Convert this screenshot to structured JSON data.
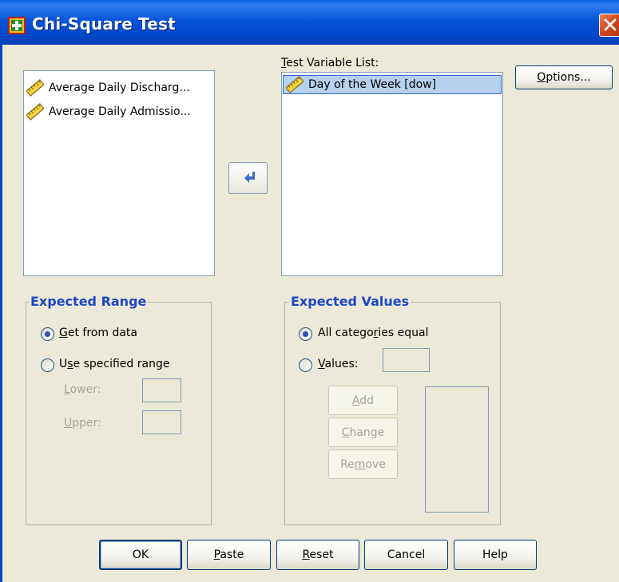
{
  "window": {
    "title": "Chi-Square Test"
  },
  "source_list": {
    "items": [
      {
        "label": "Average Daily Discharg...",
        "icon": "scale-ruler-icon"
      },
      {
        "label": "Average Daily Admissio...",
        "icon": "scale-ruler-icon"
      }
    ]
  },
  "move_button": {
    "icon": "arrow-left-icon"
  },
  "test_variable": {
    "label_prefix": "T",
    "label_rest": "est Variable List:",
    "items": [
      {
        "label": "Day of the Week [dow]",
        "icon": "scale-ruler-icon",
        "selected": true
      }
    ]
  },
  "options_button": {
    "mnemonic": "O",
    "rest": "ptions..."
  },
  "expected_range": {
    "title": "Expected Range",
    "get_from_data": {
      "mnemonic": "G",
      "rest": "et from data",
      "checked": true
    },
    "use_specified": {
      "pre": "U",
      "mnemonic": "s",
      "rest": "e specified range",
      "checked": false
    },
    "lower": {
      "mnemonic": "L",
      "rest": "ower:",
      "value": ""
    },
    "upper": {
      "mnemonic": "U",
      "rest": "pper:",
      "value": ""
    }
  },
  "expected_values": {
    "title": "Expected Values",
    "all_equal": {
      "pre": "All catego",
      "mnemonic": "r",
      "rest": "ies equal",
      "checked": true
    },
    "values": {
      "mnemonic": "V",
      "rest": "alues:",
      "checked": false,
      "value": ""
    },
    "add": {
      "mnemonic": "A",
      "rest": "dd"
    },
    "change": {
      "mnemonic": "C",
      "rest": "hange"
    },
    "remove": {
      "pre": "Re",
      "mnemonic": "m",
      "rest": "ove"
    }
  },
  "footer": {
    "ok": "OK",
    "paste": {
      "mnemonic": "P",
      "rest": "aste"
    },
    "reset": {
      "mnemonic": "R",
      "rest": "eset"
    },
    "cancel": "Cancel",
    "help": "Help"
  },
  "colors": {
    "titlebar": "#0054e3",
    "group_title": "#1c46c6",
    "selection": "#b5d1ee",
    "dialog_bg": "#ece9d8"
  }
}
